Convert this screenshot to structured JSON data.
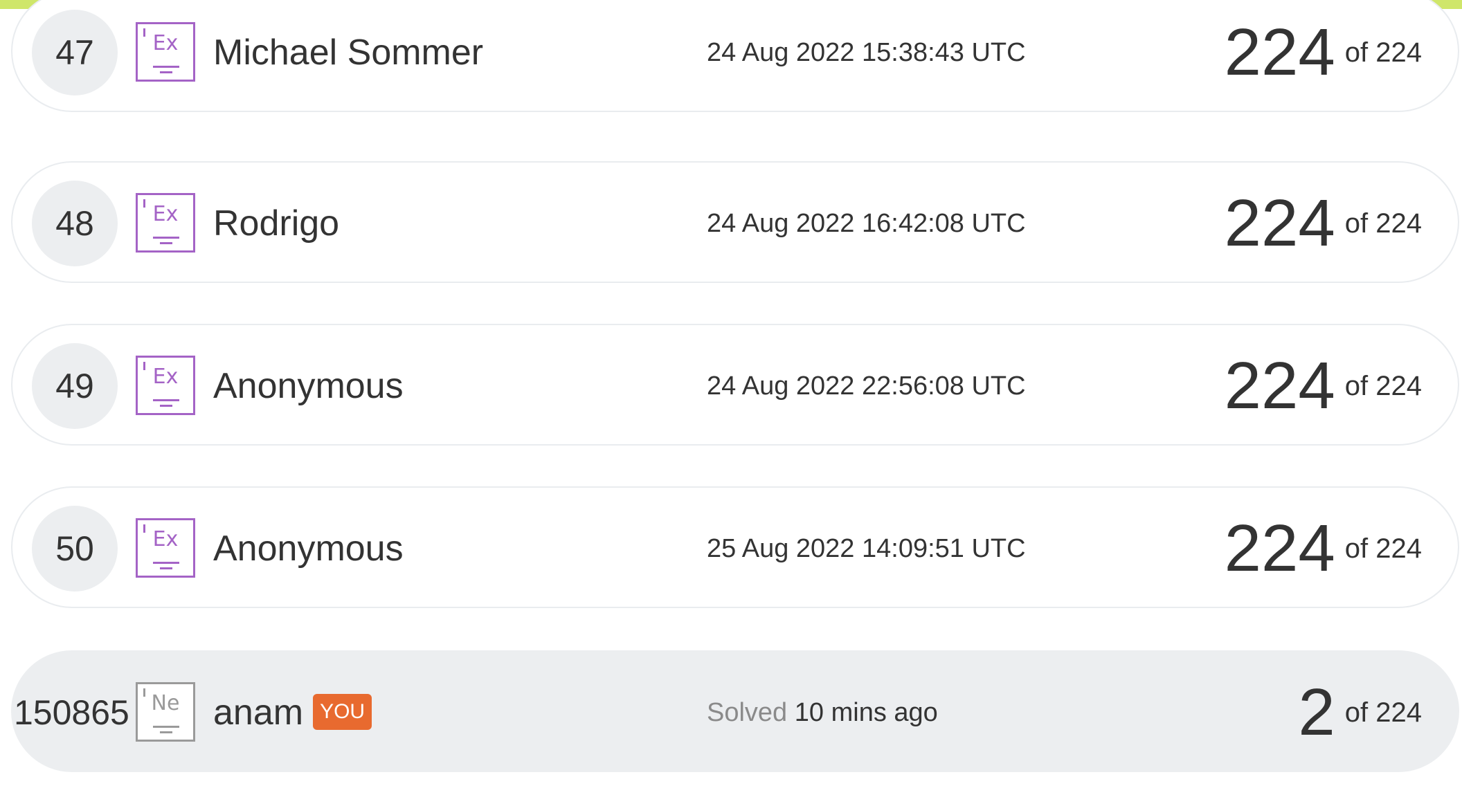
{
  "colors": {
    "top_bar": "#cfe66a",
    "element_purple": "#a463c6",
    "element_gray": "#9a9a9a",
    "you_badge": "#e86a2f",
    "current_row_bg": "#eceef0"
  },
  "leaderboard": {
    "rows": [
      {
        "rank": "47",
        "icon": "element-ex-icon",
        "symbol": "Ex",
        "name": "Michael Sommer",
        "time": "24 Aug 2022 15:38:43 UTC",
        "score": "224",
        "of_total": "of 224"
      },
      {
        "rank": "48",
        "icon": "element-ex-icon",
        "symbol": "Ex",
        "name": "Rodrigo",
        "time": "24 Aug 2022 16:42:08 UTC",
        "score": "224",
        "of_total": "of 224"
      },
      {
        "rank": "49",
        "icon": "element-ex-icon",
        "symbol": "Ex",
        "name": "Anonymous",
        "time": "24 Aug 2022 22:56:08 UTC",
        "score": "224",
        "of_total": "of 224"
      },
      {
        "rank": "50",
        "icon": "element-ex-icon",
        "symbol": "Ex",
        "name": "Anonymous",
        "time": "25 Aug 2022 14:09:51 UTC",
        "score": "224",
        "of_total": "of 224"
      }
    ],
    "current_user": {
      "rank": "150865",
      "icon": "element-ne-icon",
      "symbol": "Ne",
      "name": "anam",
      "badge": "YOU",
      "solved_label": "Solved",
      "solved_time": "10 mins ago",
      "score": "2",
      "of_total": "of 224"
    }
  }
}
